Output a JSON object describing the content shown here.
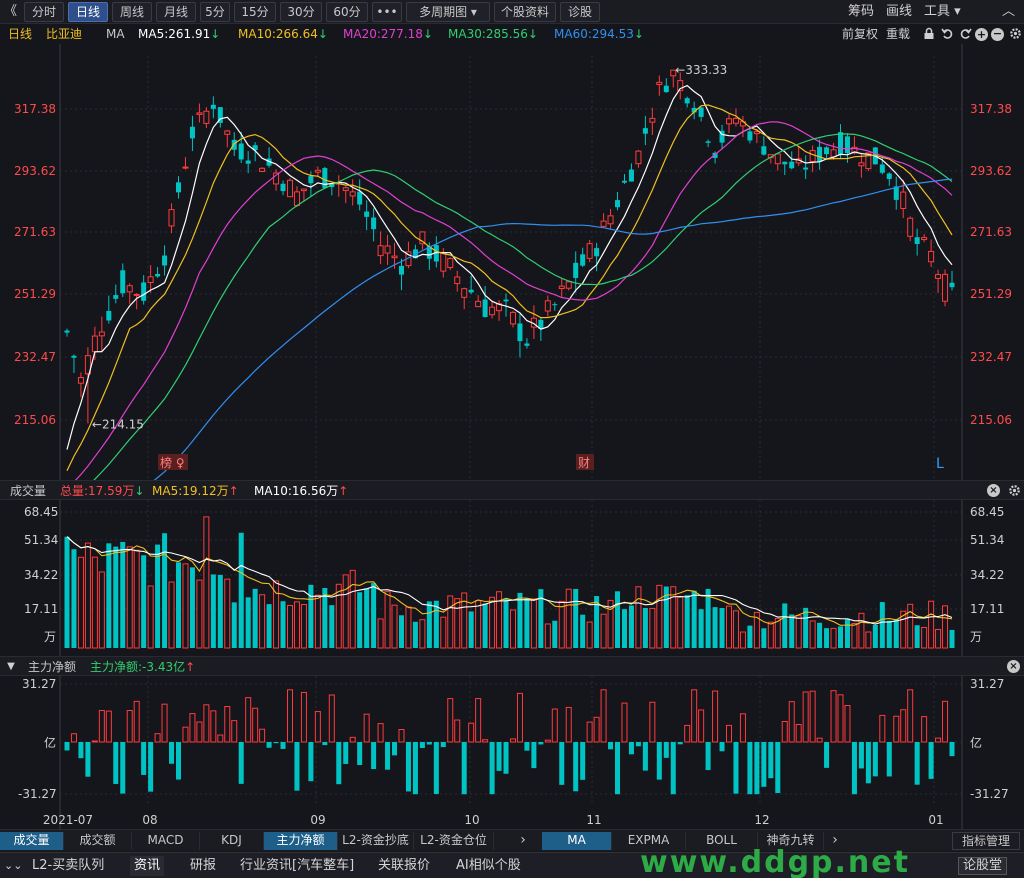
{
  "toolbar": {
    "back": "《",
    "tabs": [
      "分时",
      "日线",
      "周线",
      "月线",
      "5分",
      "15分",
      "30分",
      "60分",
      "•••",
      "多周期图 ▾",
      "个股资料",
      "诊股"
    ],
    "active_tab": 1,
    "right_items": [
      "筹码",
      "画线",
      "工具 ▾"
    ],
    "collapse": "︿"
  },
  "ma_bar": {
    "period": "日线",
    "stock": "比亚迪",
    "ma_label": "MA",
    "items": [
      {
        "text": "MA5:261.91",
        "arrow": "↓",
        "color": "#ffffff"
      },
      {
        "text": "MA10:266.64",
        "arrow": "↓",
        "color": "#f0c020"
      },
      {
        "text": "MA20:277.18",
        "arrow": "↓",
        "color": "#e040d0"
      },
      {
        "text": "MA30:285.56",
        "arrow": "↓",
        "color": "#30d070"
      },
      {
        "text": "MA60:294.53",
        "arrow": "↓",
        "color": "#3090f0"
      }
    ],
    "adjust": "前复权",
    "reload": "重载"
  },
  "price_chart": {
    "y_ticks": [
      "317.38",
      "293.62",
      "271.63",
      "251.29",
      "232.47",
      "215.06"
    ],
    "high_label": "←333.33",
    "low_label": "←214.15",
    "marker_bang": "榜",
    "marker_cai": "财",
    "marker_L": "L"
  },
  "volume": {
    "title": "成交量",
    "total": "总量:17.59万",
    "total_arrow": "↓",
    "ma5": "MA5:19.12万",
    "ma5_arrow": "↑",
    "ma10": "MA10:16.56万",
    "ma10_arrow": "↑",
    "y_ticks": [
      "68.45",
      "51.34",
      "34.22",
      "17.11"
    ],
    "unit": "万"
  },
  "net_flow": {
    "title": "主力净额",
    "value": "主力净额:-3.43亿",
    "value_arrow": "↑",
    "y_ticks": [
      "31.27",
      "亿",
      "-31.27"
    ]
  },
  "x_axis": {
    "labels": [
      "2021-07",
      "08",
      "09",
      "10",
      "11",
      "12",
      "01"
    ]
  },
  "bottom_tabs": {
    "left": [
      "成交量",
      "成交额",
      "MACD",
      "KDJ",
      "主力净额",
      "L2-资金抄底",
      "L2-资金仓位"
    ],
    "left_active": [
      0,
      4
    ],
    "arrow": "›",
    "right": [
      "MA",
      "EXPMA",
      "BOLL",
      "神奇九转"
    ],
    "right_active": 0,
    "indicator_mgmt": "指标管理"
  },
  "status_bar": {
    "items": [
      "L2-买卖队列",
      "资讯",
      "研报",
      "行业资讯[汽车整车]",
      "关联报价",
      "AI相似个股"
    ],
    "active": 1,
    "watermark": "www.ddgp.net",
    "forum": "论股堂"
  },
  "colors": {
    "up": "#ff3b3b",
    "down": "#00c4c4",
    "ma5": "#ffffff",
    "ma10": "#f0c020",
    "ma20": "#e040d0",
    "ma30": "#30d070",
    "ma60": "#3090f0",
    "axis_red": "#ff4b4b"
  }
}
